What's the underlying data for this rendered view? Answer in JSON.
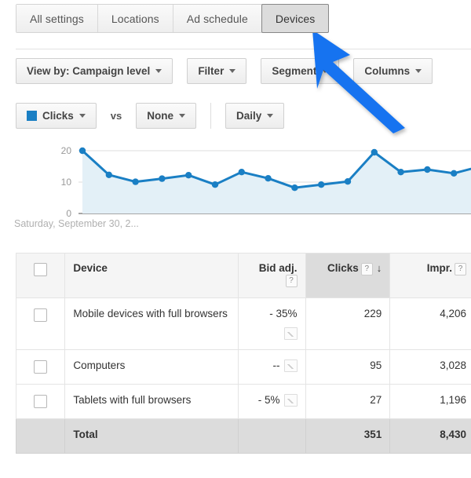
{
  "tabs": [
    {
      "label": "All settings",
      "active": false
    },
    {
      "label": "Locations",
      "active": false
    },
    {
      "label": "Ad schedule",
      "active": false
    },
    {
      "label": "Devices",
      "active": true
    }
  ],
  "toolbar": {
    "row1": [
      {
        "label": "View by: Campaign level"
      },
      {
        "label": "Filter"
      },
      {
        "label": "Segment"
      },
      {
        "label": "Columns"
      }
    ],
    "metric_label": "Clicks",
    "metric_color": "#1a7fc4",
    "vs_label": "vs",
    "compare_label": "None",
    "granularity_label": "Daily"
  },
  "chart_data": {
    "type": "line",
    "title": "",
    "xlabel": "Saturday, September 30, 2...",
    "ylabel": "",
    "ylim": [
      0,
      20
    ],
    "yticks": [
      0,
      10,
      20
    ],
    "grid": true,
    "legend": [
      "Clicks"
    ],
    "series": [
      {
        "name": "Clicks",
        "color": "#1a7fc4",
        "fill": "#e3f0f7",
        "values": [
          20.0,
          12.3,
          10.1,
          11.1,
          12.2,
          9.2,
          13.2,
          11.2,
          8.2,
          9.2,
          10.2,
          19.5,
          13.2,
          14.0,
          12.8,
          15.0
        ]
      }
    ]
  },
  "table": {
    "columns": [
      {
        "key": "check",
        "label": ""
      },
      {
        "key": "device",
        "label": "Device"
      },
      {
        "key": "bid",
        "label": "Bid adj.",
        "help": "?"
      },
      {
        "key": "clicks",
        "label": "Clicks",
        "help": "?",
        "sorted": true,
        "sort_dir": "↓"
      },
      {
        "key": "impr",
        "label": "Impr.",
        "help": "?"
      }
    ],
    "rows": [
      {
        "device": "Mobile devices with full browsers",
        "bid": "- 35%",
        "clicks": "229",
        "impr": "4,206"
      },
      {
        "device": "Computers",
        "bid": "--",
        "clicks": "95",
        "impr": "3,028"
      },
      {
        "device": "Tablets with full browsers",
        "bid": "- 5%",
        "clicks": "27",
        "impr": "1,196"
      }
    ],
    "total": {
      "device": "Total",
      "bid": "",
      "clicks": "351",
      "impr": "8,430"
    }
  },
  "overlay": {
    "arrow_color": "#1273f0",
    "arrow_name": "cursor-arrow-annotation"
  }
}
